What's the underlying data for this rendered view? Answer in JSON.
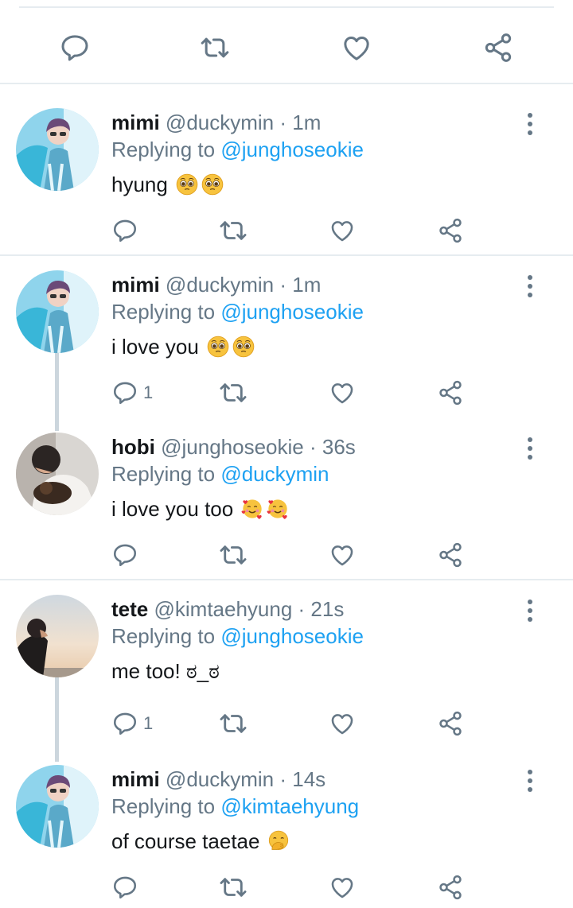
{
  "colors": {
    "accent": "#1da1f2",
    "muted": "#657786",
    "divider": "#e6ecf0"
  },
  "main_actions": {
    "icons": [
      "reply-icon",
      "retweet-icon",
      "like-icon",
      "share-icon"
    ]
  },
  "tweets": [
    {
      "display_name": "mimi",
      "handle": "@duckymin",
      "time": "· 1m",
      "replying_label": "Replying to",
      "replying_to": "@junghoseokie",
      "text": "hyung",
      "emojis": [
        "pleading-face",
        "pleading-face"
      ],
      "reply_count": ""
    },
    {
      "display_name": "mimi",
      "handle": "@duckymin",
      "time": "· 1m",
      "replying_label": "Replying to",
      "replying_to": "@junghoseokie",
      "text": "i love you",
      "emojis": [
        "pleading-face",
        "pleading-face"
      ],
      "reply_count": "1"
    },
    {
      "display_name": "hobi",
      "handle": "@junghoseokie",
      "time": "· 36s",
      "replying_label": "Replying to",
      "replying_to": "@duckymin",
      "text": "i love you too",
      "emojis": [
        "smiling-face-with-hearts",
        "smiling-face-with-hearts"
      ],
      "reply_count": ""
    },
    {
      "display_name": "tete",
      "handle": "@kimtaehyung",
      "time": "· 21s",
      "replying_label": "Replying to",
      "replying_to": "@junghoseokie",
      "text": "me too! ಠ_ಠ",
      "emojis": [],
      "reply_count": "1"
    },
    {
      "display_name": "mimi",
      "handle": "@duckymin",
      "time": "· 14s",
      "replying_label": "Replying to",
      "replying_to": "@kimtaehyung",
      "text": "of course taetae",
      "emojis": [
        "face-with-hand-over-mouth"
      ],
      "reply_count": ""
    }
  ]
}
